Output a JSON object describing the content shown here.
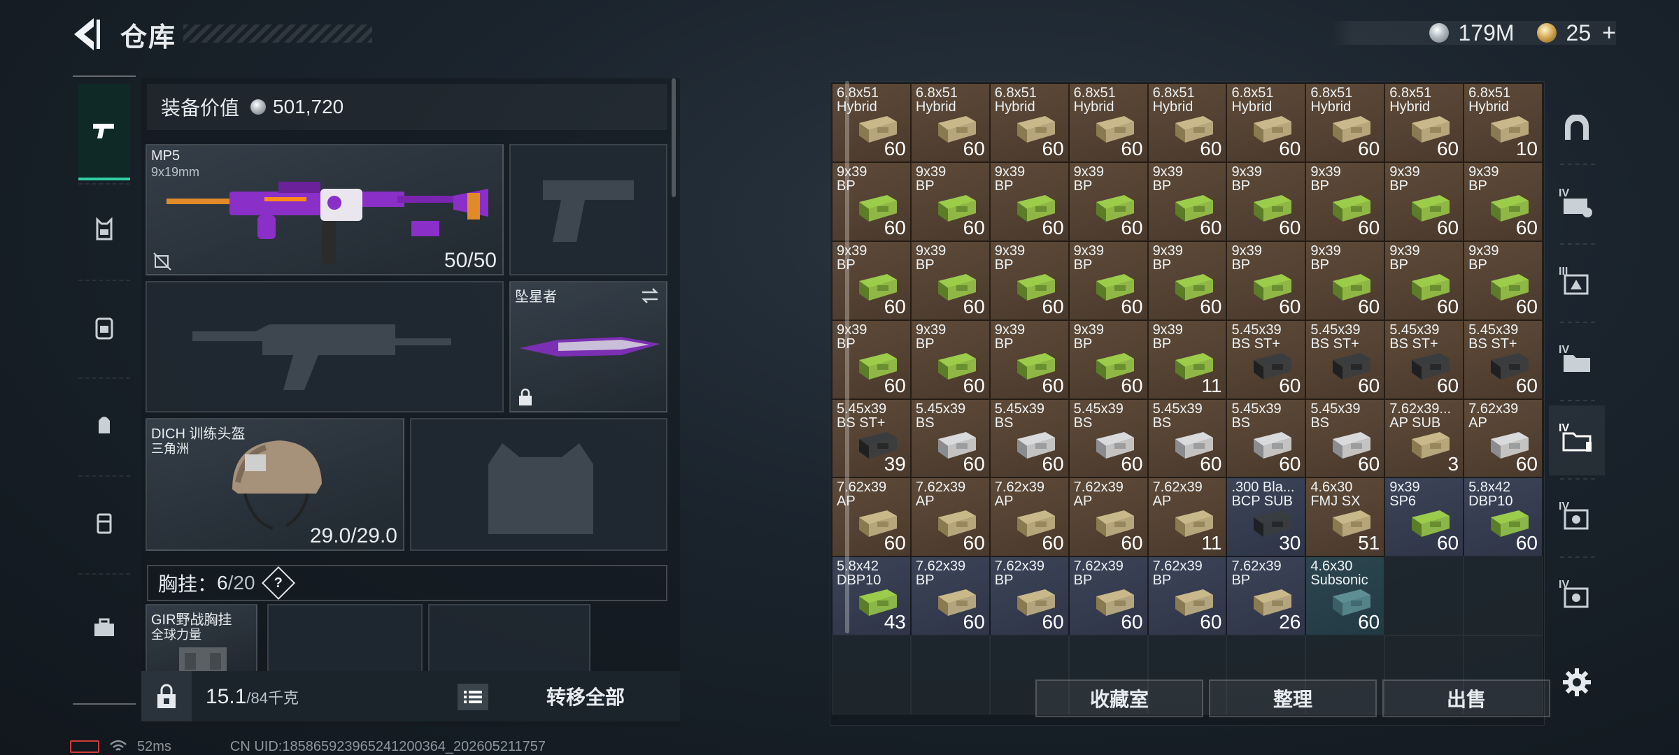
{
  "header": {
    "title": "仓库",
    "silver_value": "179M",
    "gold_value": "25",
    "plus": "+"
  },
  "loadout": {
    "equip_value_label": "装备价值",
    "equip_value": "501,720",
    "primary": {
      "name": "MP5",
      "caliber": "9x19mm",
      "ammo": "50/50"
    },
    "melee": {
      "name": "坠星者"
    },
    "helmet": {
      "name": "DICH 训练头盔",
      "origin": "三角洲",
      "durability": "29.0/29.0"
    },
    "chest_rig_label": "胸挂：",
    "chest_rig_used": "6",
    "chest_rig_cap": "/20",
    "chest_rig_help": "?",
    "rig_item": {
      "name": "GIR野战胸挂",
      "origin": "全球力量"
    },
    "weight": "15.1",
    "weight_cap": "/84千克",
    "transfer_all": "转移全部"
  },
  "storage": {
    "items": [
      {
        "cal": "6.8x51",
        "type": "Hybrid",
        "qty": "60",
        "bg": "brown",
        "box": "khaki"
      },
      {
        "cal": "6.8x51",
        "type": "Hybrid",
        "qty": "60",
        "bg": "brown",
        "box": "khaki"
      },
      {
        "cal": "6.8x51",
        "type": "Hybrid",
        "qty": "60",
        "bg": "brown",
        "box": "khaki"
      },
      {
        "cal": "6.8x51",
        "type": "Hybrid",
        "qty": "60",
        "bg": "brown",
        "box": "khaki"
      },
      {
        "cal": "6.8x51",
        "type": "Hybrid",
        "qty": "60",
        "bg": "brown",
        "box": "khaki"
      },
      {
        "cal": "6.8x51",
        "type": "Hybrid",
        "qty": "60",
        "bg": "brown",
        "box": "khaki"
      },
      {
        "cal": "6.8x51",
        "type": "Hybrid",
        "qty": "60",
        "bg": "brown",
        "box": "khaki"
      },
      {
        "cal": "6.8x51",
        "type": "Hybrid",
        "qty": "60",
        "bg": "brown",
        "box": "khaki"
      },
      {
        "cal": "6.8x51",
        "type": "Hybrid",
        "qty": "10",
        "bg": "brown",
        "box": "khaki"
      },
      {
        "cal": "9x39",
        "type": "BP",
        "qty": "60",
        "bg": "brown",
        "box": "green"
      },
      {
        "cal": "9x39",
        "type": "BP",
        "qty": "60",
        "bg": "brown",
        "box": "green"
      },
      {
        "cal": "9x39",
        "type": "BP",
        "qty": "60",
        "bg": "brown",
        "box": "green"
      },
      {
        "cal": "9x39",
        "type": "BP",
        "qty": "60",
        "bg": "brown",
        "box": "green"
      },
      {
        "cal": "9x39",
        "type": "BP",
        "qty": "60",
        "bg": "brown",
        "box": "green"
      },
      {
        "cal": "9x39",
        "type": "BP",
        "qty": "60",
        "bg": "brown",
        "box": "green"
      },
      {
        "cal": "9x39",
        "type": "BP",
        "qty": "60",
        "bg": "brown",
        "box": "green"
      },
      {
        "cal": "9x39",
        "type": "BP",
        "qty": "60",
        "bg": "brown",
        "box": "green"
      },
      {
        "cal": "9x39",
        "type": "BP",
        "qty": "60",
        "bg": "brown",
        "box": "green"
      },
      {
        "cal": "9x39",
        "type": "BP",
        "qty": "60",
        "bg": "brown",
        "box": "green"
      },
      {
        "cal": "9x39",
        "type": "BP",
        "qty": "60",
        "bg": "brown",
        "box": "green"
      },
      {
        "cal": "9x39",
        "type": "BP",
        "qty": "60",
        "bg": "brown",
        "box": "green"
      },
      {
        "cal": "9x39",
        "type": "BP",
        "qty": "60",
        "bg": "brown",
        "box": "green"
      },
      {
        "cal": "9x39",
        "type": "BP",
        "qty": "60",
        "bg": "brown",
        "box": "green"
      },
      {
        "cal": "9x39",
        "type": "BP",
        "qty": "60",
        "bg": "brown",
        "box": "green"
      },
      {
        "cal": "9x39",
        "type": "BP",
        "qty": "60",
        "bg": "brown",
        "box": "green"
      },
      {
        "cal": "9x39",
        "type": "BP",
        "qty": "60",
        "bg": "brown",
        "box": "green"
      },
      {
        "cal": "9x39",
        "type": "BP",
        "qty": "60",
        "bg": "brown",
        "box": "green"
      },
      {
        "cal": "9x39",
        "type": "BP",
        "qty": "60",
        "bg": "brown",
        "box": "green"
      },
      {
        "cal": "9x39",
        "type": "BP",
        "qty": "60",
        "bg": "brown",
        "box": "green"
      },
      {
        "cal": "9x39",
        "type": "BP",
        "qty": "60",
        "bg": "brown",
        "box": "green"
      },
      {
        "cal": "9x39",
        "type": "BP",
        "qty": "60",
        "bg": "brown",
        "box": "green"
      },
      {
        "cal": "9x39",
        "type": "BP",
        "qty": "11",
        "bg": "brown",
        "box": "green"
      },
      {
        "cal": "5.45x39",
        "type": "BS ST+",
        "qty": "60",
        "bg": "brown",
        "box": "dark"
      },
      {
        "cal": "5.45x39",
        "type": "BS ST+",
        "qty": "60",
        "bg": "brown",
        "box": "dark"
      },
      {
        "cal": "5.45x39",
        "type": "BS ST+",
        "qty": "60",
        "bg": "brown",
        "box": "dark"
      },
      {
        "cal": "5.45x39",
        "type": "BS ST+",
        "qty": "60",
        "bg": "brown",
        "box": "dark"
      },
      {
        "cal": "5.45x39",
        "type": "BS ST+",
        "qty": "39",
        "bg": "brown",
        "box": "dark"
      },
      {
        "cal": "5.45x39",
        "type": "BS",
        "qty": "60",
        "bg": "brown",
        "box": "white"
      },
      {
        "cal": "5.45x39",
        "type": "BS",
        "qty": "60",
        "bg": "brown",
        "box": "white"
      },
      {
        "cal": "5.45x39",
        "type": "BS",
        "qty": "60",
        "bg": "brown",
        "box": "white"
      },
      {
        "cal": "5.45x39",
        "type": "BS",
        "qty": "60",
        "bg": "brown",
        "box": "white"
      },
      {
        "cal": "5.45x39",
        "type": "BS",
        "qty": "60",
        "bg": "brown",
        "box": "white"
      },
      {
        "cal": "5.45x39",
        "type": "BS",
        "qty": "60",
        "bg": "brown",
        "box": "white"
      },
      {
        "cal": "7.62x39...",
        "type": "AP SUB",
        "qty": "3",
        "bg": "brown",
        "box": "khaki"
      },
      {
        "cal": "7.62x39",
        "type": "AP",
        "qty": "60",
        "bg": "brown",
        "box": "white"
      },
      {
        "cal": "7.62x39",
        "type": "AP",
        "qty": "60",
        "bg": "brown",
        "box": "khaki"
      },
      {
        "cal": "7.62x39",
        "type": "AP",
        "qty": "60",
        "bg": "brown",
        "box": "khaki"
      },
      {
        "cal": "7.62x39",
        "type": "AP",
        "qty": "60",
        "bg": "brown",
        "box": "khaki"
      },
      {
        "cal": "7.62x39",
        "type": "AP",
        "qty": "60",
        "bg": "brown",
        "box": "khaki"
      },
      {
        "cal": "7.62x39",
        "type": "AP",
        "qty": "11",
        "bg": "brown",
        "box": "khaki"
      },
      {
        "cal": ".300 Bla...",
        "type": "BCP SUB",
        "qty": "30",
        "bg": "blue",
        "box": "dark"
      },
      {
        "cal": "4.6x30",
        "type": "FMJ SX",
        "qty": "51",
        "bg": "brown",
        "box": "khaki"
      },
      {
        "cal": "9x39",
        "type": "SP6",
        "qty": "60",
        "bg": "blue",
        "box": "green"
      },
      {
        "cal": "5.8x42",
        "type": "DBP10",
        "qty": "60",
        "bg": "blue",
        "box": "green"
      },
      {
        "cal": "5.8x42",
        "type": "DBP10",
        "qty": "43",
        "bg": "blue",
        "box": "green"
      },
      {
        "cal": "7.62x39",
        "type": "BP",
        "qty": "60",
        "bg": "blue",
        "box": "khaki"
      },
      {
        "cal": "7.62x39",
        "type": "BP",
        "qty": "60",
        "bg": "blue",
        "box": "khaki"
      },
      {
        "cal": "7.62x39",
        "type": "BP",
        "qty": "60",
        "bg": "blue",
        "box": "khaki"
      },
      {
        "cal": "7.62x39",
        "type": "BP",
        "qty": "60",
        "bg": "blue",
        "box": "khaki"
      },
      {
        "cal": "7.62x39",
        "type": "BP",
        "qty": "26",
        "bg": "blue",
        "box": "khaki"
      },
      {
        "cal": "4.6x30",
        "type": "Subsonic",
        "qty": "60",
        "bg": "teal",
        "box": "teal"
      }
    ],
    "empty_cells": 11,
    "buttons": {
      "collection": "收藏室",
      "sort": "整理",
      "sell": "出售"
    }
  },
  "right_nav": {
    "levels": [
      "IV",
      "III",
      "IV",
      "IV",
      "IV",
      "IV"
    ]
  },
  "status": {
    "ping": "52ms",
    "uid": "CN UID:18586592396524120036​4_202605211757"
  },
  "colors": {
    "accent": "#2fd1a3",
    "cell_brown": "#5e4a38",
    "cell_blue": "#3c4458",
    "cell_teal": "#2c4650"
  }
}
